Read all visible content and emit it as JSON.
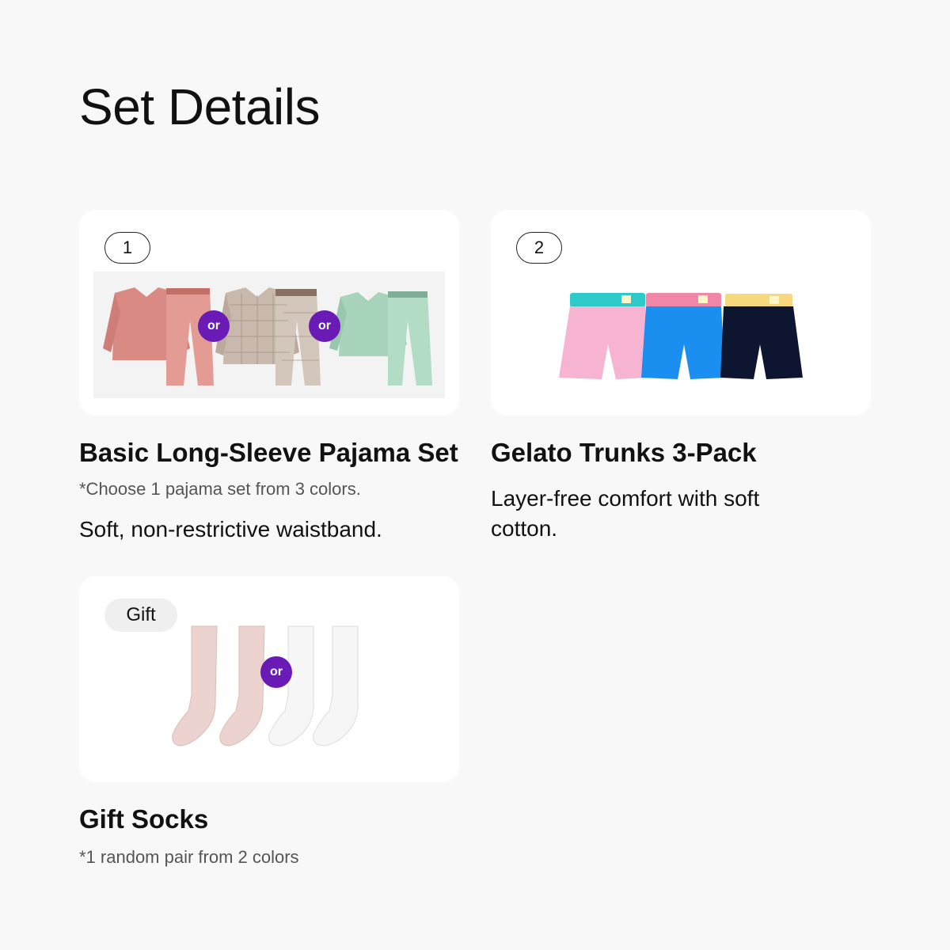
{
  "page": {
    "title": "Set Details"
  },
  "items": [
    {
      "badge": "1",
      "title": "Basic Long-Sleeve Pajama Set",
      "note": "*Choose 1 pajama set from 3 colors.",
      "description": "Soft, non-restrictive waistband.",
      "or_label": "or",
      "variants": [
        {
          "color": "#d98a83",
          "accent": "#e8a59c"
        },
        {
          "color": "#c8b9ac",
          "accent": "#8a6f63"
        },
        {
          "color": "#a8d4bc",
          "accent": "#7fae98"
        }
      ]
    },
    {
      "badge": "2",
      "title": "Gelato Trunks 3-Pack",
      "description": "Layer-free comfort with soft cotton.",
      "variants": [
        {
          "color": "#f7b3d2",
          "band": "#2ec9c9"
        },
        {
          "color": "#1a8ff0",
          "band": "#f087a8"
        },
        {
          "color": "#0d1530",
          "band": "#f5d97c"
        }
      ]
    },
    {
      "badge": "Gift",
      "title": "Gift Socks",
      "note": "*1 random pair from 2 colors",
      "or_label": "or",
      "variants": [
        {
          "color": "#ecd3cf"
        },
        {
          "color": "#f6f6f6"
        }
      ]
    }
  ],
  "colors": {
    "accent": "#6a1bb5",
    "background": "#f8f8f8",
    "card": "#ffffff"
  }
}
